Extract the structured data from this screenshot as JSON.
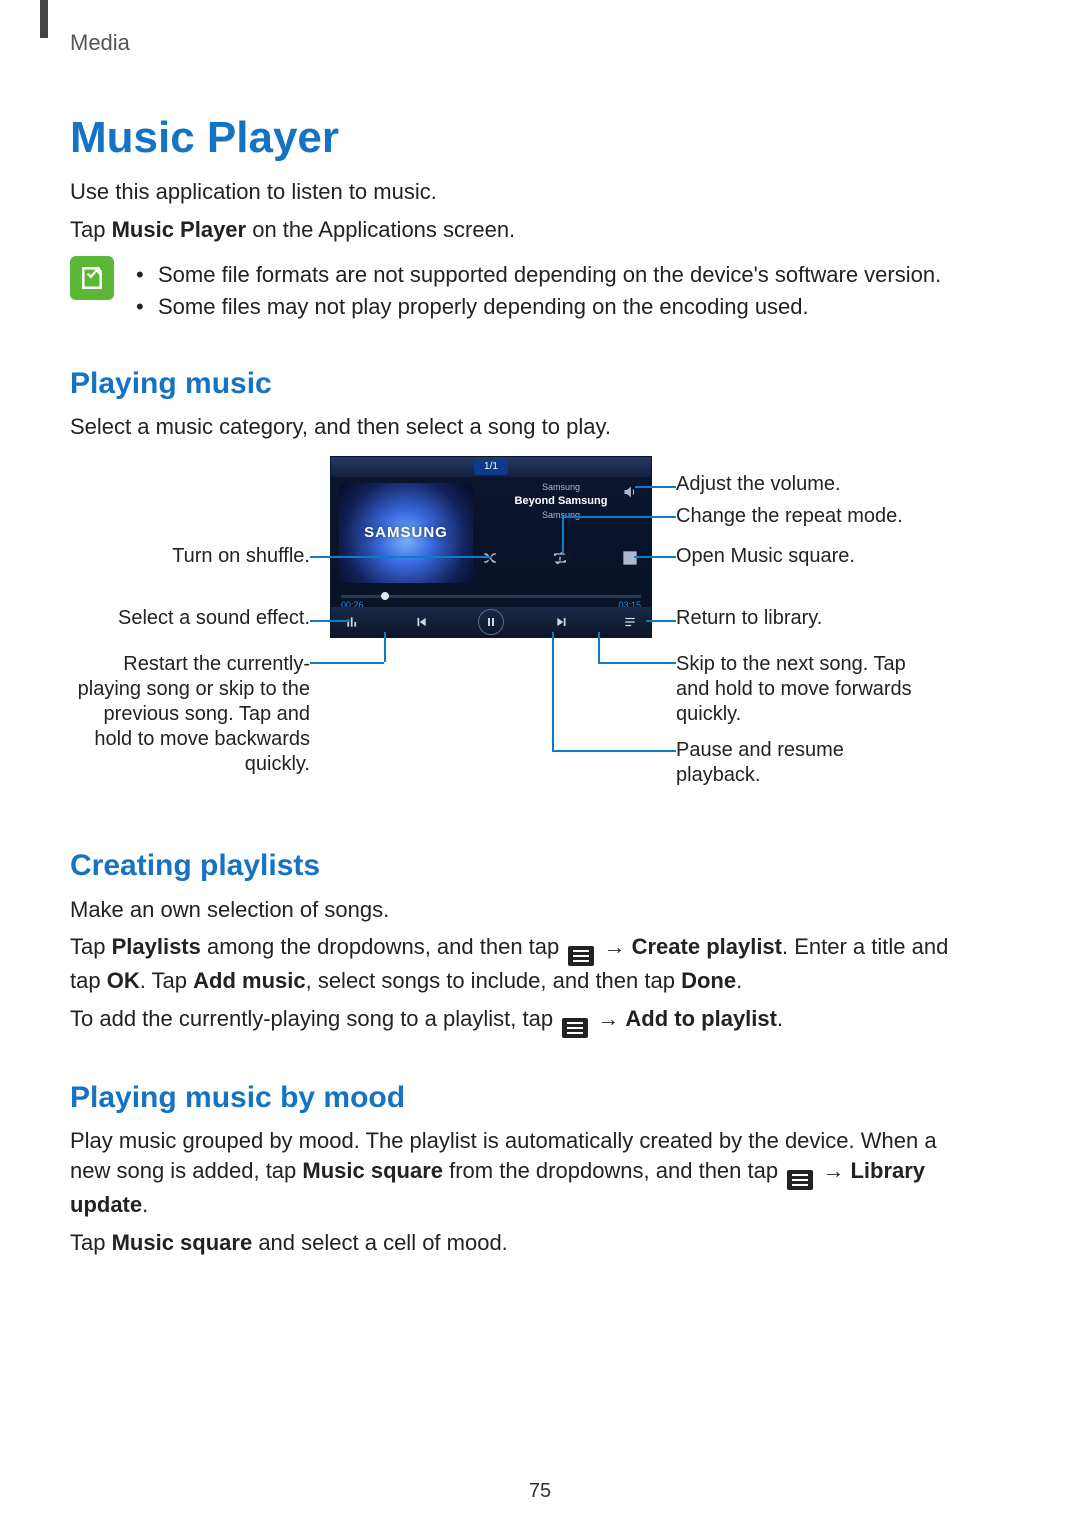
{
  "header": {
    "section": "Media"
  },
  "title": "Music Player",
  "intro1": "Use this application to listen to music.",
  "intro2_pre": "Tap ",
  "intro2_bold": "Music Player",
  "intro2_post": " on the Applications screen.",
  "notes": {
    "n1": "Some file formats are not supported depending on the device's software version.",
    "n2": "Some files may not play properly depending on the encoding used."
  },
  "playing": {
    "heading": "Playing music",
    "desc": "Select a music category, and then select a song to play."
  },
  "callouts": {
    "volume": "Adjust the volume.",
    "repeat": "Change the repeat mode.",
    "shuffle": "Turn on shuffle.",
    "sound_effect": "Select a sound effect.",
    "music_square": "Open Music square.",
    "library": "Return to library.",
    "next": "Skip to the next song. Tap and hold to move forwards quickly.",
    "prev": "Restart the currently-playing song or skip to the previous song. Tap and hold to move backwards quickly.",
    "pause": "Pause and resume playback."
  },
  "player": {
    "counter": "1/1",
    "artist_small": "Samsung",
    "track": "Beyond Samsung",
    "album": "Samsung",
    "art_label": "SAMSUNG",
    "time_elapsed": "00:26",
    "time_total": "03:15"
  },
  "creating": {
    "heading": "Creating playlists",
    "l1": "Make an own selection of songs.",
    "l2a": "Tap ",
    "l2b": "Playlists",
    "l2c": " among the dropdowns, and then tap ",
    "arrow": " → ",
    "l2d": "Create playlist",
    "l2e": ". Enter a title and tap ",
    "l3a": "OK",
    "l3b": ". Tap ",
    "l3c": "Add music",
    "l3d": ", select songs to include, and then tap ",
    "l3e": "Done",
    "l3f": ".",
    "l4a": "To add the currently-playing song to a playlist, tap ",
    "l4b": "Add to playlist",
    "l4c": "."
  },
  "mood": {
    "heading": "Playing music by mood",
    "l1a": "Play music grouped by mood. The playlist is automatically created by the device. When a new song is added, tap ",
    "l1b": "Music square",
    "l1c": " from the dropdowns, and then tap ",
    "l1d": "Library update",
    "l1e": ".",
    "l2a": "Tap ",
    "l2b": "Music square",
    "l2c": " and select a cell of mood."
  },
  "page_number": "75"
}
